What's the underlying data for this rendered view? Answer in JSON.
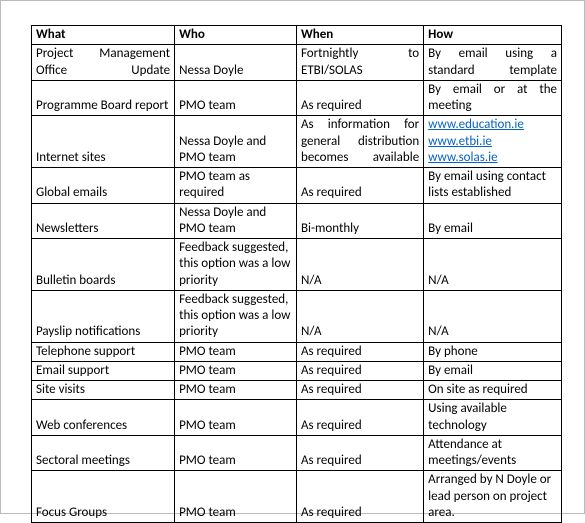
{
  "headers": {
    "c1": "What",
    "c2": "Who",
    "c3": "When",
    "c4": "How"
  },
  "rows": [
    {
      "what": "Project Management Office Update",
      "who": "Nessa Doyle",
      "when": "Fortnightly to ETBI/SOLAS",
      "how": "By email using a standard template"
    },
    {
      "what": "Programme Board report",
      "who": "PMO team",
      "when": "As required",
      "how": "By email or at the meeting"
    },
    {
      "what": "Internet sites",
      "who": "Nessa Doyle and PMO team",
      "when": "As information for general distribution becomes available",
      "how_links": [
        "www.education.ie",
        "www.etbi.ie",
        "www.solas.ie"
      ]
    },
    {
      "what": "Global emails",
      "who": "PMO team as required",
      "when": "As required",
      "how": "By email using contact lists established"
    },
    {
      "what": "Newsletters",
      "who": "Nessa Doyle and PMO team",
      "when": "Bi-monthly",
      "how": "By email"
    },
    {
      "what": "Bulletin boards",
      "who": "Feedback suggested, this option was a low priority",
      "when": "N/A",
      "how": "N/A"
    },
    {
      "what": "Payslip notifications",
      "who": "Feedback suggested, this option was a low priority",
      "when": "N/A",
      "how": "N/A"
    },
    {
      "what": "Telephone support",
      "who": "PMO team",
      "when": "As required",
      "how": "By phone"
    },
    {
      "what": "Email support",
      "who": "PMO team",
      "when": "As required",
      "how": "By email"
    },
    {
      "what": "Site visits",
      "who": "PMO team",
      "when": "As required",
      "how": "On site as required"
    },
    {
      "what": "Web conferences",
      "who": "PMO team",
      "when": "As required",
      "how": "Using available technology"
    },
    {
      "what": "Sectoral meetings",
      "who": "PMO team",
      "when": "As required",
      "how": "Attendance at meetings/events"
    },
    {
      "what": "Focus Groups",
      "who": "PMO team",
      "when": "As required",
      "how": "Arranged by N Doyle or lead person on project area."
    }
  ]
}
